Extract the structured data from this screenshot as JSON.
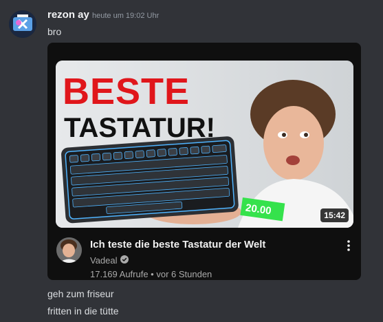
{
  "message": {
    "author": "rezon ay",
    "timestamp": "heute um 19:02 Uhr",
    "text": "bro"
  },
  "embed": {
    "thumbnail_text_line1": "BESTE",
    "thumbnail_text_line2": "TASTATUR!",
    "thumbnail_sticker": "20.00",
    "duration": "15:42",
    "video_title": "Ich teste die beste Tastatur der Welt",
    "channel_name": "Vadeal",
    "stats": "17.169 Aufrufe • vor 6 Stunden",
    "verified_icon": "verified-check-icon",
    "more_icon": "more-vertical-icon"
  },
  "followups": [
    {
      "text": "geh zum friseur"
    },
    {
      "text": "fritten in die tütte"
    }
  ],
  "colors": {
    "background": "#313338",
    "embed_background": "#0f0f0f",
    "title_red": "#e0161b",
    "keyboard_glow": "#4fb4ff"
  }
}
